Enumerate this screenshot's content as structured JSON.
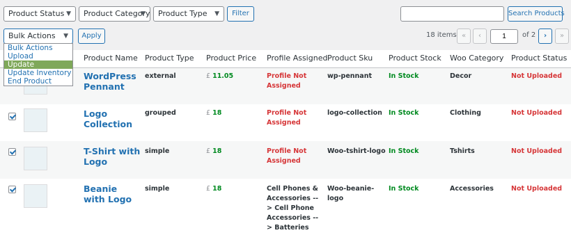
{
  "filters": {
    "status_label": "Product Status",
    "category_label": "Product Category",
    "type_label": "Product Type",
    "filter_button": "Filter",
    "search_placeholder": "",
    "search_button": "Search Products"
  },
  "bulk": {
    "selected": "Bulk Actions",
    "apply_button": "Apply",
    "options": [
      "Bulk Actions",
      "Upload",
      "Update",
      "Update Inventory",
      "End Product"
    ],
    "highlighted_index": 2
  },
  "pagination": {
    "items_text": "18 items",
    "first": "«",
    "prev": "‹",
    "current_page": "1",
    "of_text": "of 2",
    "next": "›",
    "last": "»"
  },
  "columns": [
    "Product Name",
    "Product Type",
    "Product Price",
    "Profile Assigned",
    "Product Sku",
    "Product Stock",
    "Woo Category",
    "Product Status"
  ],
  "rows": [
    {
      "name": "WordPress Pennant",
      "type": "external",
      "currency": "£",
      "price": "11.05",
      "profile": "Profile Not Assigned",
      "sku": "wp-pennant",
      "stock": "In Stock",
      "category": "Decor",
      "status": "Not Uploaded"
    },
    {
      "name": "Logo Collection",
      "type": "grouped",
      "currency": "£",
      "price": "18",
      "profile": "Profile Not Assigned",
      "sku": "logo-collection",
      "stock": "In Stock",
      "category": "Clothing",
      "status": "Not Uploaded"
    },
    {
      "name": "T-Shirt with Logo",
      "type": "simple",
      "currency": "£",
      "price": "18",
      "profile": "Profile Not Assigned",
      "sku": "Woo-tshirt-logo",
      "stock": "In Stock",
      "category": "Tshirts",
      "status": "Not Uploaded"
    },
    {
      "name": "Beanie with Logo",
      "type": "simple",
      "currency": "£",
      "price": "18",
      "profile": "Cell Phones & Accessories --> Cell Phone Accessories --> Batteries",
      "sku": "Woo-beanie-logo",
      "stock": "In Stock",
      "category": "Accessories",
      "status": "Not Uploaded"
    }
  ],
  "colors": {
    "accent": "#2271b1",
    "success": "#008a20",
    "danger": "#d63638",
    "highlight": "#7fa85a"
  }
}
